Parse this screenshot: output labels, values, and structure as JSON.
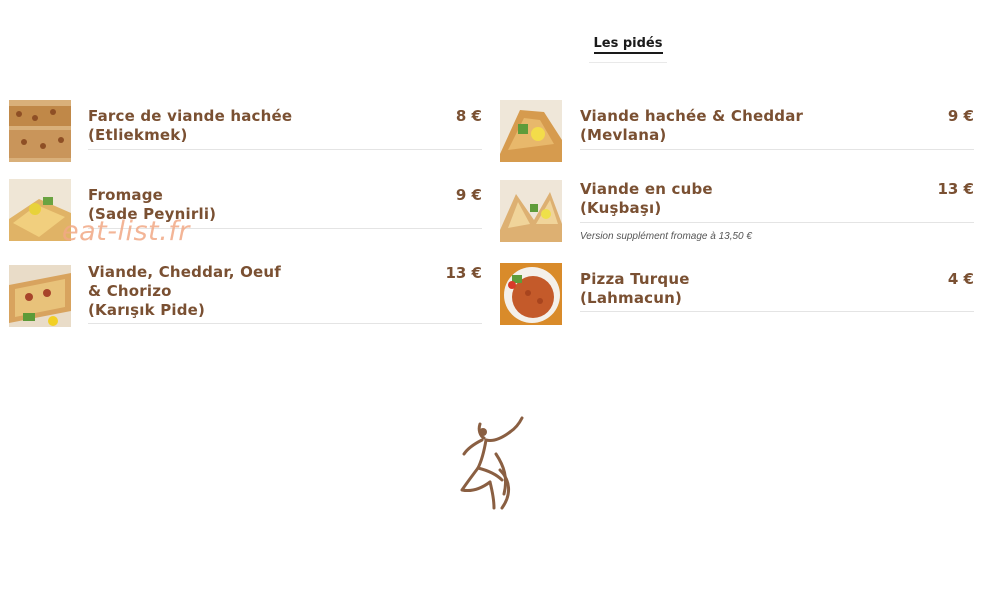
{
  "section": {
    "title": "Les pidés"
  },
  "left_items": [
    {
      "name_lines": [
        "Farce de viande hachée",
        "(Etliekmek)"
      ],
      "price": "8 €"
    },
    {
      "name_lines": [
        "Fromage",
        "(Sade Peynirli)"
      ],
      "price": "9 €"
    },
    {
      "name_lines": [
        "Viande, Cheddar, Oeuf",
        "& Chorizo",
        "(Karışık Pide)"
      ],
      "price": "13 €"
    }
  ],
  "right_items": [
    {
      "name_lines": [
        "Viande hachée & Cheddar",
        "(Mevlana)"
      ],
      "price": "9 €"
    },
    {
      "name_lines": [
        "Viande en cube",
        "(Kuşbaşı)"
      ],
      "price": "13 €",
      "note": "Version supplément fromage à 13,50 €"
    },
    {
      "name_lines": [
        "Pizza Turque",
        "(Lahmacun)"
      ],
      "price": "4 €"
    }
  ],
  "watermark": "eat-list.fr",
  "colors": {
    "accent": "#7a5032",
    "watermark": "#f2a985"
  },
  "icons": [
    "pide-photo",
    "whirling-dervish-logo"
  ]
}
